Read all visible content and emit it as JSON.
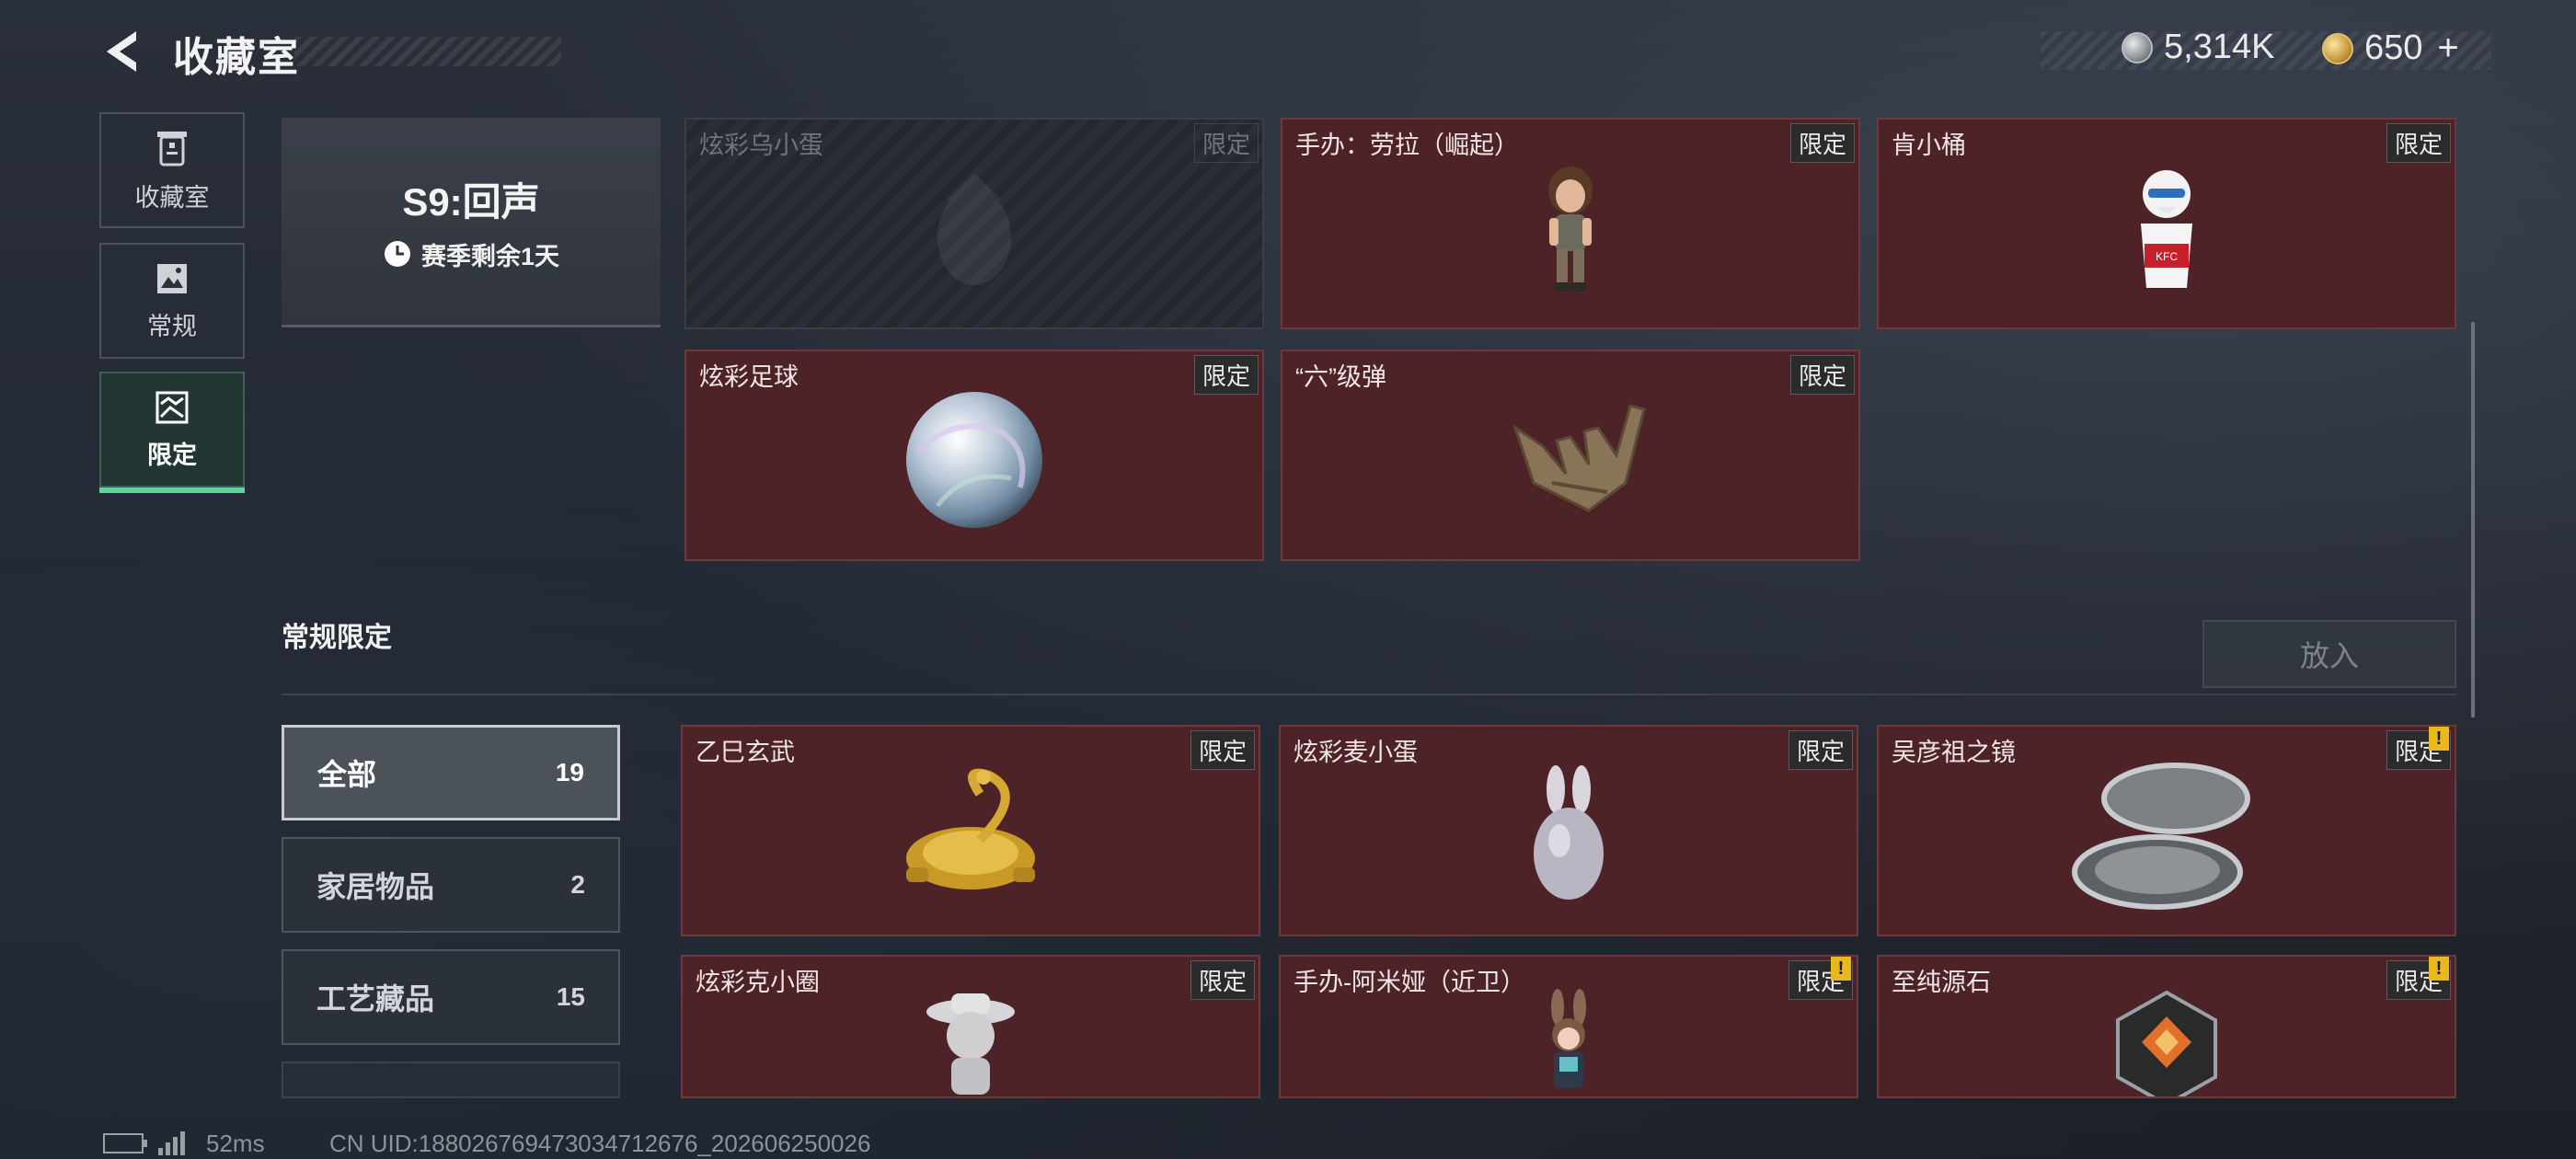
{
  "header": {
    "title": "收藏室",
    "coins": "5,314K",
    "tokens": "650",
    "plus": "+"
  },
  "nav": [
    {
      "label": "收藏室",
      "icon": "trash-can-icon",
      "active": false
    },
    {
      "label": "常规",
      "icon": "picture-icon",
      "active": false
    },
    {
      "label": "限定",
      "icon": "landscape-icon",
      "active": true
    }
  ],
  "season": {
    "name": "S9:回声",
    "remaining": "赛季剩余1天"
  },
  "season_items": [
    {
      "name": "炫彩乌小蛋",
      "badge": "限定",
      "locked": true,
      "icon": "bird-egg-icon"
    },
    {
      "name": "手办：劳拉（崛起）",
      "badge": "限定",
      "locked": false,
      "icon": "figure-lara-icon"
    },
    {
      "name": "肯小桶",
      "badge": "限定",
      "locked": false,
      "icon": "kfc-bucket-figure-icon"
    },
    {
      "name": "炫彩足球",
      "badge": "限定",
      "locked": false,
      "icon": "iridescent-ball-icon"
    },
    {
      "name": "“六”级弹",
      "badge": "限定",
      "locked": false,
      "icon": "hand-gesture-icon"
    }
  ],
  "section": {
    "title": "常规限定",
    "put_button": "放入"
  },
  "filters": [
    {
      "label": "全部",
      "count": "19",
      "active": true
    },
    {
      "label": "家居物品",
      "count": "2",
      "active": false
    },
    {
      "label": "工艺藏品",
      "count": "15",
      "active": false
    }
  ],
  "regular_items": [
    {
      "name": "乙巳玄武",
      "badge": "限定",
      "warn": false,
      "icon": "golden-snake-turtle-icon"
    },
    {
      "name": "炫彩麦小蛋",
      "badge": "限定",
      "warn": false,
      "icon": "bunny-egg-icon"
    },
    {
      "name": "吴彦祖之镜",
      "badge": "限定",
      "warn": true,
      "icon": "compact-mirror-icon"
    },
    {
      "name": "炫彩克小圈",
      "badge": "限定",
      "warn": false,
      "icon": "hat-figure-icon"
    },
    {
      "name": "手办-阿米娅（近卫）",
      "badge": "限定",
      "warn": true,
      "icon": "figure-amiya-icon"
    },
    {
      "name": "至纯源石",
      "badge": "限定",
      "warn": true,
      "icon": "originium-stone-icon"
    }
  ],
  "warn_mark": "!",
  "status": {
    "ping": "52ms",
    "uid": "CN UID:1880267694730347126​76_202606250026"
  },
  "colors": {
    "card_bg": "#4e2328",
    "accent_green": "#5fd39c",
    "warn_yellow": "#e8b81d"
  }
}
